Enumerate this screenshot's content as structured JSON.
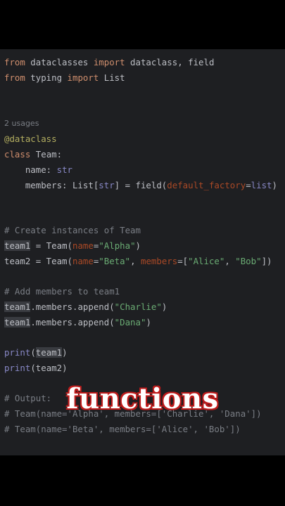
{
  "code": {
    "import1": {
      "kw1": "from",
      "mod": " dataclasses ",
      "kw2": "import",
      "rest": " dataclass, field"
    },
    "import2": {
      "kw1": "from",
      "mod": " typing ",
      "kw2": "import",
      "rest": " List"
    },
    "usages": "2 usages",
    "decorator": "@dataclass",
    "class_line": {
      "kw": "class",
      "rest": " Team:"
    },
    "field_name": {
      "indent": "    name: ",
      "type": "str"
    },
    "field_members": {
      "indent": "    members: List[",
      "type": "str",
      "mid": "] = field(",
      "param": "default_factory",
      "eq": "=",
      "val": "list",
      "end": ")"
    },
    "comment_create": "# Create instances of Team",
    "team1_line": {
      "var": "team1",
      "a": " = Team(",
      "param": "name",
      "eq": "=",
      "str": "\"Alpha\"",
      "end": ")"
    },
    "team2_line": {
      "a": "team2 = Team(",
      "p1": "name",
      "eq1": "=",
      "s1": "\"Beta\"",
      "sep": ", ",
      "p2": "members",
      "eq2": "=[",
      "s2": "\"Alice\"",
      "sep2": ", ",
      "s3": "\"Bob\"",
      "end": "])"
    },
    "comment_add": "# Add members to team1",
    "append1": {
      "var": "team1",
      "a": ".members.append(",
      "str": "\"Charlie\"",
      "end": ")"
    },
    "append2": {
      "var": "team1",
      "a": ".members.append(",
      "str": "\"Dana\"",
      "end": ")"
    },
    "print1": {
      "fn": "print",
      "a": "(",
      "var": "team1",
      "end": ")"
    },
    "print2": {
      "fn": "print",
      "a": "(team2)"
    },
    "comment_output": "# Output:",
    "comment_out1": "# Team(name='Alpha', members=['Charlie', 'Dana'])",
    "comment_out2": "# Team(name='Beta', members=['Alice', 'Bob'])"
  },
  "overlay_caption": "functions"
}
